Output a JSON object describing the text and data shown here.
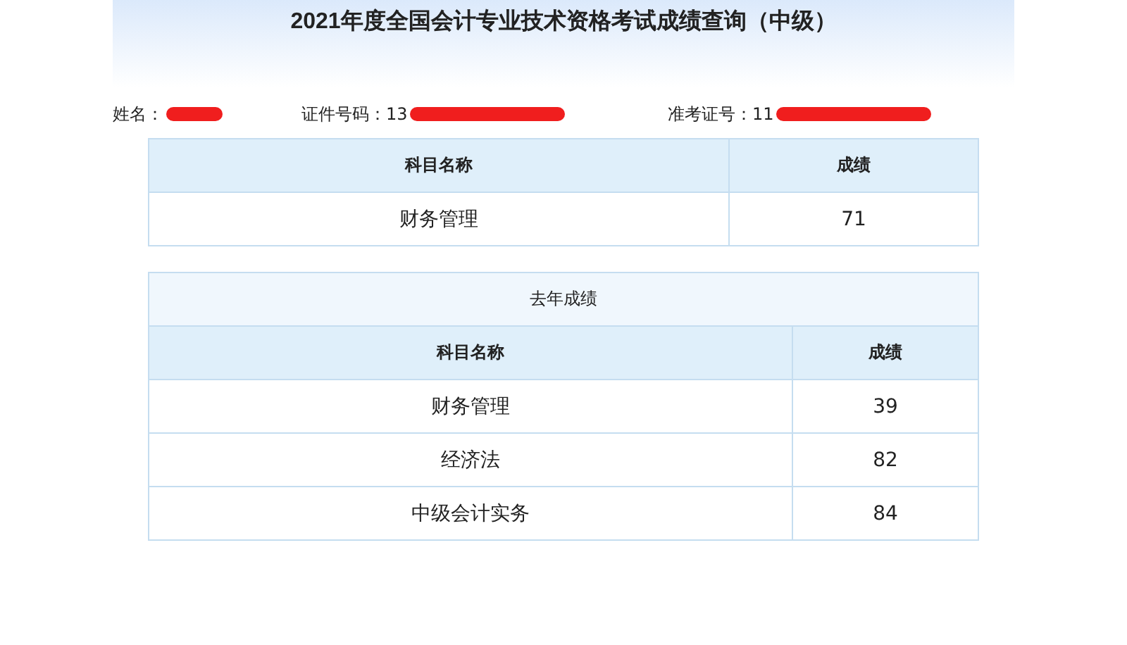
{
  "title": "2021年度全国会计专业技术资格考试成绩查询（中级）",
  "info": [
    {
      "label": "姓名："
    },
    {
      "label": "证件号码：",
      "value": "13"
    },
    {
      "label": "准考证号：",
      "value": "11"
    }
  ],
  "current": {
    "columns": [
      "科目名称",
      "成绩"
    ],
    "rows": [
      [
        "财务管理",
        "71"
      ]
    ]
  },
  "last_year": {
    "caption": "去年成绩",
    "columns": [
      "科目名称",
      "成绩"
    ],
    "rows": [
      [
        "财务管理",
        "39"
      ],
      [
        "经济法",
        "82"
      ],
      [
        "中级会计实务",
        "84"
      ]
    ]
  }
}
